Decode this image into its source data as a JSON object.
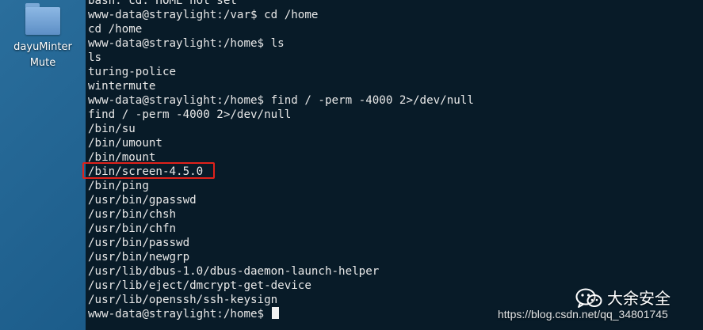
{
  "desktop": {
    "icon": {
      "name": "dayuMinterMute",
      "label_line1": "dayuMinter",
      "label_line2": "Mute",
      "icon": "folder-icon"
    }
  },
  "terminal": {
    "lines": [
      "bash: cd: HOME not set",
      "www-data@straylight:/var$ cd /home",
      "cd /home",
      "www-data@straylight:/home$ ls",
      "ls",
      "turing-police",
      "wintermute",
      "www-data@straylight:/home$ find / -perm -4000 2>/dev/null",
      "find / -perm -4000 2>/dev/null",
      "/bin/su",
      "/bin/umount",
      "/bin/mount",
      "/bin/screen-4.5.0",
      "/bin/ping",
      "/usr/bin/gpasswd",
      "/usr/bin/chsh",
      "/usr/bin/chfn",
      "/usr/bin/passwd",
      "/usr/bin/newgrp",
      "/usr/lib/dbus-1.0/dbus-daemon-launch-helper",
      "/usr/lib/eject/dmcrypt-get-device",
      "/usr/lib/openssh/ssh-keysign"
    ],
    "prompt": "www-data@straylight:/home$ ",
    "highlighted_line": "/bin/screen-4.5.0",
    "highlight_color": "#e0221b"
  },
  "watermark": {
    "channel_name": "大余安全",
    "channel_icon": "wechat-icon",
    "url": "https://blog.csdn.net/qq_34801745"
  }
}
